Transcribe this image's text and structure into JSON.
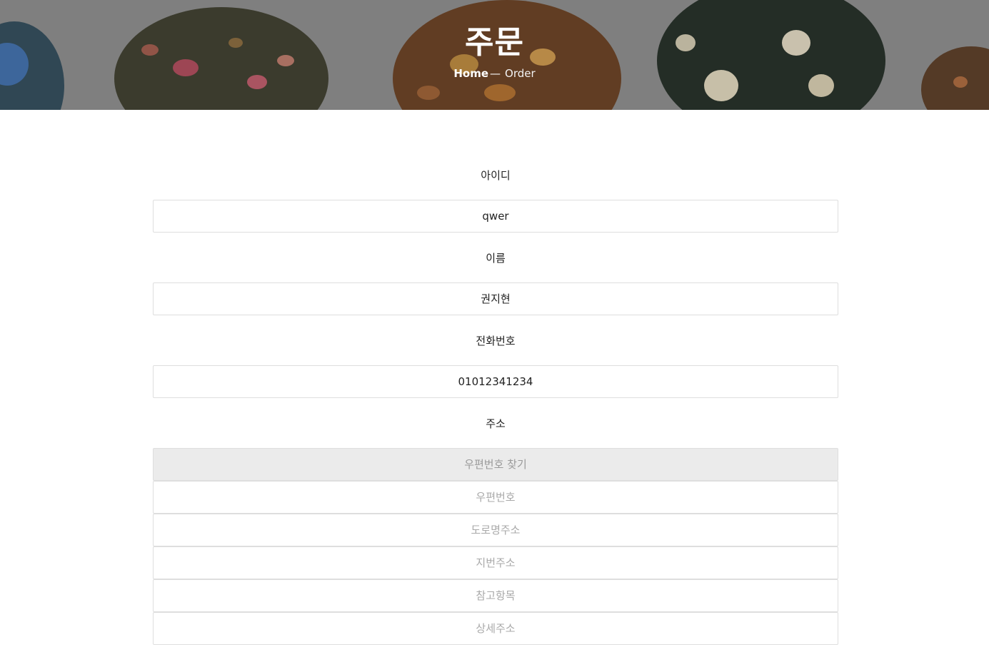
{
  "header": {
    "title": "주문",
    "breadcrumb": {
      "home": "Home",
      "separator": "—",
      "current": "Order"
    }
  },
  "form": {
    "id_label": "아이디",
    "id_value": "qwer",
    "name_label": "이름",
    "name_value": "권지현",
    "phone_label": "전화번호",
    "phone_value": "01012341234",
    "address_label": "주소",
    "zip_search_button": "우편번호 찾기",
    "zip_placeholder": "우편번호",
    "road_address_placeholder": "도로명주소",
    "jibun_address_placeholder": "지번주소",
    "reference_placeholder": "참고항목",
    "detail_address_placeholder": "상세주소"
  }
}
